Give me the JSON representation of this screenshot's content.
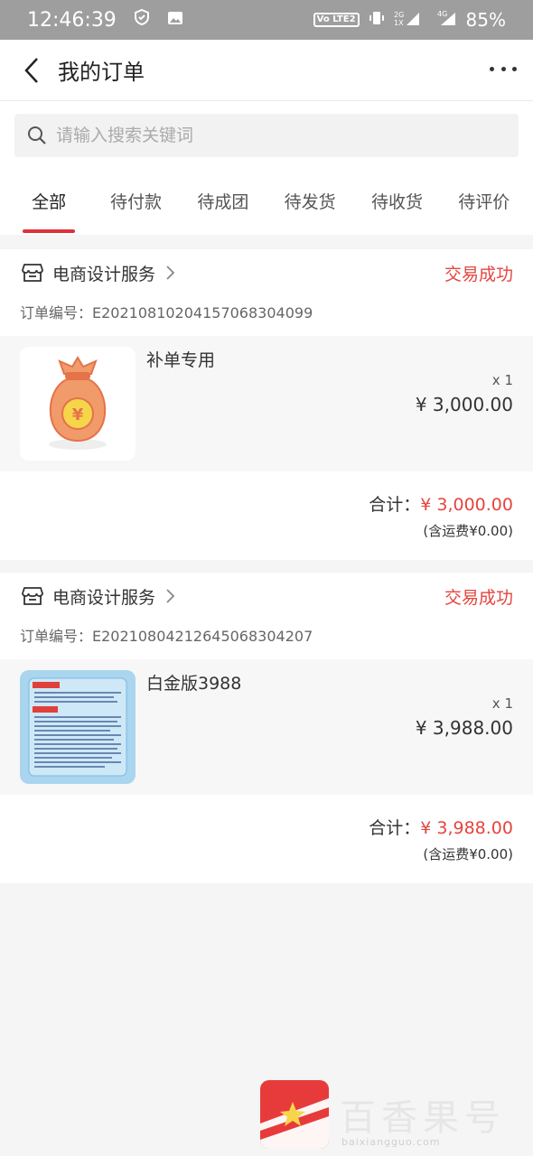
{
  "status_bar": {
    "time": "12:46:39",
    "volte": "VoLTE2",
    "network": "2G 1X 4G",
    "battery": "85%"
  },
  "header": {
    "title": "我的订单"
  },
  "search": {
    "placeholder": "请输入搜索关键词"
  },
  "tabs": [
    {
      "label": "全部",
      "active": true
    },
    {
      "label": "待付款"
    },
    {
      "label": "待成团"
    },
    {
      "label": "待发货"
    },
    {
      "label": "待收货"
    },
    {
      "label": "待评价"
    }
  ],
  "orders": [
    {
      "shop": "电商设计服务",
      "status": "交易成功",
      "order_no": "订单编号：E20210810204157068304099",
      "item_name": "补单专用",
      "qty": "x 1",
      "price": "¥ 3,000.00",
      "total_label": "合计：",
      "total": "¥ 3,000.00",
      "shipping": "(含运费¥0.00)"
    },
    {
      "shop": "电商设计服务",
      "status": "交易成功",
      "order_no": "订单编号：E20210804212645068304207",
      "item_name": "白金版3988",
      "qty": "x 1",
      "price": "¥ 3,988.00",
      "total_label": "合计：",
      "total": "¥ 3,988.00",
      "shipping": "(含运费¥0.00)"
    }
  ],
  "watermark": {
    "text": "百香果号",
    "sub": "baixiangguo.com"
  },
  "colors": {
    "accent": "#e0303b",
    "status": "#e5453f"
  }
}
